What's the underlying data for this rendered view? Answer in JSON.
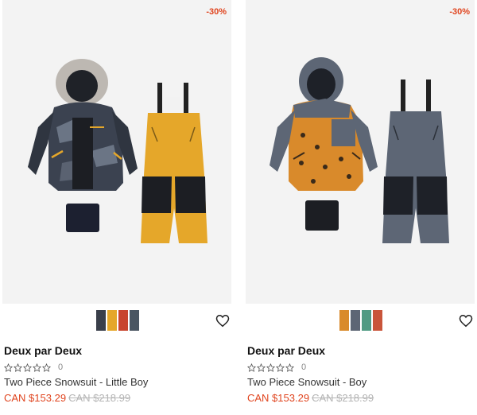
{
  "products": [
    {
      "discount": "-30%",
      "brand": "Deux par Deux",
      "rating_count": "0",
      "title": "Two Piece Snowsuit - Little Boy",
      "sale_price": "CAN $153.29",
      "original_price": "CAN $218.99",
      "swatch_colors": [
        "#3a3f4a",
        "#e5a72a",
        "#c8452e",
        "#4a5562"
      ],
      "icons": {
        "favorite": "heart-outline-icon",
        "star": "star-outline-icon"
      }
    },
    {
      "discount": "-30%",
      "brand": "Deux par Deux",
      "rating_count": "0",
      "title": "Two Piece Snowsuit - Boy",
      "sale_price": "CAN $153.29",
      "original_price": "CAN $218.99",
      "swatch_colors": [
        "#d98a2b",
        "#5d6675",
        "#4f9a82",
        "#c9553a"
      ],
      "icons": {
        "favorite": "heart-outline-icon",
        "star": "star-outline-icon"
      }
    }
  ],
  "colors": {
    "sale": "#e0441e",
    "strike": "#b5b5b5",
    "image_bg": "#f3f3f3"
  }
}
